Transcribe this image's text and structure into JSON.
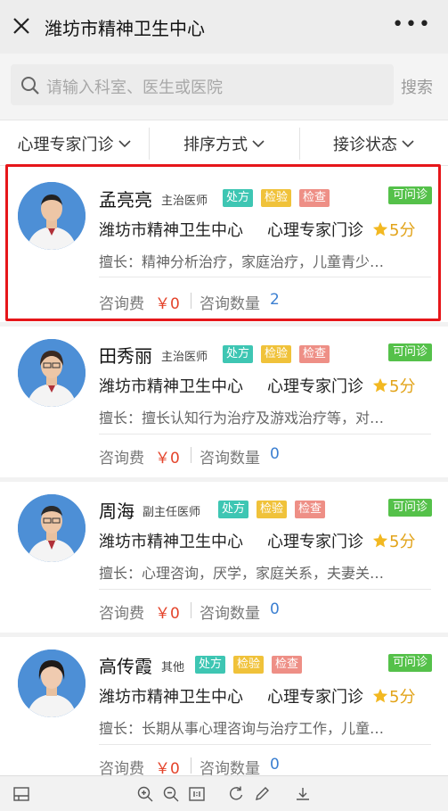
{
  "window": {
    "title": "潍坊市精神卫生中心"
  },
  "search": {
    "placeholder": "请输入科室、医生或医院",
    "button": "搜索"
  },
  "filters": [
    {
      "label": "心理专家门诊"
    },
    {
      "label": "排序方式"
    },
    {
      "label": "接诊状态"
    }
  ],
  "doctors": [
    {
      "name": "孟亮亮",
      "rank": "主治医师",
      "tags": [
        "处方",
        "检验",
        "检查"
      ],
      "status": "可问诊",
      "hospital": "潍坊市精神卫生中心",
      "department": "心理专家门诊",
      "rating": "5分",
      "specialty": "擅长：精神分析治疗，家庭治疗，儿童青少…",
      "fee_label": "咨询费",
      "fee": "￥0",
      "count_label": "咨询数量",
      "count": "2",
      "avatar_color": "#4d8fd6"
    },
    {
      "name": "田秀丽",
      "rank": "主治医师",
      "tags": [
        "处方",
        "检验",
        "检查"
      ],
      "status": "可问诊",
      "hospital": "潍坊市精神卫生中心",
      "department": "心理专家门诊",
      "rating": "5分",
      "specialty": "擅长：擅长认知行为治疗及游戏治疗等，对…",
      "fee_label": "咨询费",
      "fee": "￥0",
      "count_label": "咨询数量",
      "count": "0",
      "avatar_color": "#4d8fd6"
    },
    {
      "name": "周海",
      "rank": "副主任医师",
      "tags": [
        "处方",
        "检验",
        "检查"
      ],
      "status": "可问诊",
      "hospital": "潍坊市精神卫生中心",
      "department": "心理专家门诊",
      "rating": "5分",
      "specialty": "擅长：心理咨询，厌学，家庭关系，夫妻关…",
      "fee_label": "咨询费",
      "fee": "￥0",
      "count_label": "咨询数量",
      "count": "0",
      "avatar_color": "#4d8fd6"
    },
    {
      "name": "高传霞",
      "rank": "其他",
      "tags": [
        "处方",
        "检验",
        "检查"
      ],
      "status": "可问诊",
      "hospital": "潍坊市精神卫生中心",
      "department": "心理专家门诊",
      "rating": "5分",
      "specialty": "擅长：长期从事心理咨询与治疗工作，儿童…",
      "fee_label": "咨询费",
      "fee": "￥0",
      "count_label": "咨询数量",
      "count": "0",
      "avatar_color": "#4d8fd6"
    }
  ],
  "colors": {
    "accent_red": "#e4442b",
    "star": "#e2a319",
    "available": "#55c14a",
    "highlight_border": "#e6161a"
  },
  "bottom_toolbar": {
    "icons": [
      "sidebar-icon",
      "zoom-in-icon",
      "zoom-out-icon",
      "actual-size-icon",
      "rotate-icon",
      "edit-icon",
      "download-icon"
    ]
  }
}
